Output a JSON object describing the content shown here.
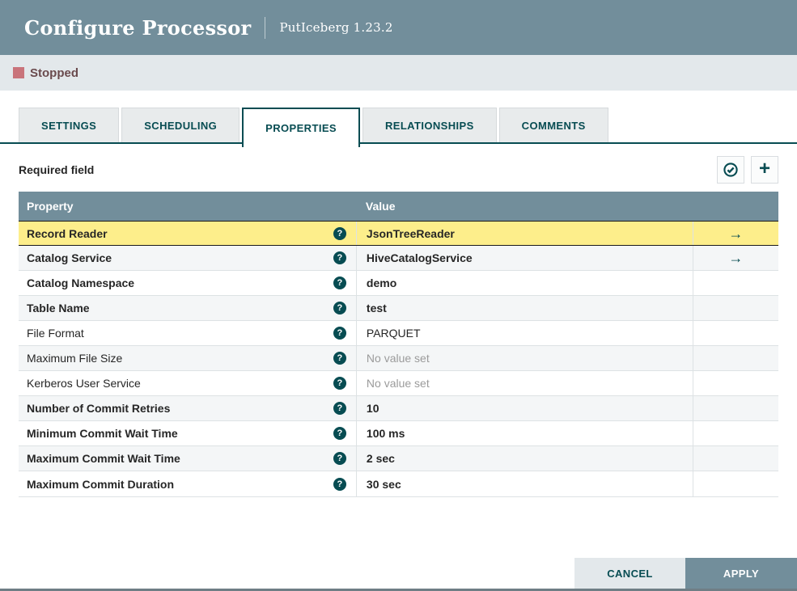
{
  "dialog": {
    "title": "Configure Processor",
    "subtitle": "PutIceberg 1.23.2"
  },
  "status": {
    "label": "Stopped",
    "icon": "stopped-square",
    "square_color": "#C9747B",
    "text_color": "#6A4A4D"
  },
  "tabs": [
    {
      "label": "SETTINGS",
      "active": false
    },
    {
      "label": "SCHEDULING",
      "active": false
    },
    {
      "label": "PROPERTIES",
      "active": true
    },
    {
      "label": "RELATIONSHIPS",
      "active": false
    },
    {
      "label": "COMMENTS",
      "active": false
    }
  ],
  "toolbar": {
    "required_label": "Required field",
    "buttons": [
      {
        "name": "verify-properties",
        "icon": "check-circle"
      },
      {
        "name": "add-property",
        "icon": "plus"
      }
    ]
  },
  "table": {
    "columns": [
      "Property",
      "Value"
    ],
    "help_icon": "question-mark-circle",
    "link_icon": "right-arrow",
    "rows": [
      {
        "property": "Record Reader",
        "value": "JsonTreeReader",
        "required": true,
        "selected": true,
        "has_link": true,
        "value_state": "set"
      },
      {
        "property": "Catalog Service",
        "value": "HiveCatalogService",
        "required": true,
        "selected": false,
        "has_link": true,
        "value_state": "set"
      },
      {
        "property": "Catalog Namespace",
        "value": "demo",
        "required": true,
        "selected": false,
        "has_link": false,
        "value_state": "set"
      },
      {
        "property": "Table Name",
        "value": "test",
        "required": true,
        "selected": false,
        "has_link": false,
        "value_state": "set"
      },
      {
        "property": "File Format",
        "value": "PARQUET",
        "required": false,
        "selected": false,
        "has_link": false,
        "value_state": "default"
      },
      {
        "property": "Maximum File Size",
        "value": "No value set",
        "required": false,
        "selected": false,
        "has_link": false,
        "value_state": "unset"
      },
      {
        "property": "Kerberos User Service",
        "value": "No value set",
        "required": false,
        "selected": false,
        "has_link": false,
        "value_state": "unset"
      },
      {
        "property": "Number of Commit Retries",
        "value": "10",
        "required": true,
        "selected": false,
        "has_link": false,
        "value_state": "set"
      },
      {
        "property": "Minimum Commit Wait Time",
        "value": "100 ms",
        "required": true,
        "selected": false,
        "has_link": false,
        "value_state": "set"
      },
      {
        "property": "Maximum Commit Wait Time",
        "value": "2 sec",
        "required": true,
        "selected": false,
        "has_link": false,
        "value_state": "set"
      },
      {
        "property": "Maximum Commit Duration",
        "value": "30 sec",
        "required": true,
        "selected": false,
        "has_link": false,
        "value_state": "set"
      }
    ]
  },
  "footer": {
    "cancel_label": "CANCEL",
    "apply_label": "APPLY"
  },
  "colors": {
    "header_slate": "#728E9B",
    "accent_teal": "#074C52",
    "status_bar": "#E3E8EB",
    "selected_row_yellow": "#FDEE8B",
    "alt_row": "#F4F6F7"
  }
}
